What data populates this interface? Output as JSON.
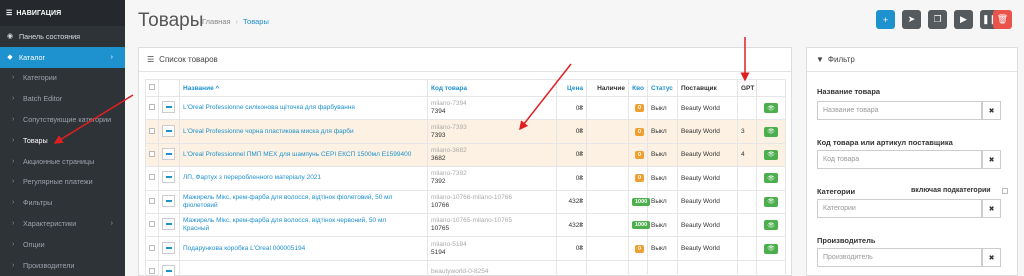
{
  "sidebar": {
    "header": "НАВИГАЦИЯ",
    "items": [
      {
        "label": "Панель состояния",
        "icon": "dashboard-icon"
      },
      {
        "label": "Каталог",
        "icon": "tag-icon"
      },
      {
        "label": "Категории"
      },
      {
        "label": "Batch Editor"
      },
      {
        "label": "Сопутствующие категории"
      },
      {
        "label": "Товары"
      },
      {
        "label": "Акционные страницы"
      },
      {
        "label": "Регулярные платежи"
      },
      {
        "label": "Фильтры"
      },
      {
        "label": "Характеристики"
      },
      {
        "label": "Опции"
      },
      {
        "label": "Производители"
      }
    ]
  },
  "header": {
    "title": "Товары",
    "breadcrumb": [
      "Главная",
      "Товары"
    ]
  },
  "product_list": {
    "title": "Список товаров",
    "columns": {
      "name": "Название ^",
      "code": "Код товара",
      "price": "Цена",
      "availability": "Наличие",
      "qty": "Кво",
      "status": "Статус",
      "supplier": "Поставщик",
      "gpt": "GPT"
    },
    "rows": [
      {
        "name": "L'Oreal Professionne силіконова щіточка для фарбування",
        "name2": "",
        "code_alt": "milano-7394",
        "code": "7394",
        "price": "0₴",
        "qty": "0",
        "qty_color": "orange",
        "status": "Выкл",
        "supplier": "Beauty World",
        "gpt": ""
      },
      {
        "name": "L'Oreal Professionne чорна пластикова миска для фарби",
        "name2": "",
        "code_alt": "milano-7393",
        "code": "7393",
        "price": "0₴",
        "qty": "0",
        "qty_color": "orange",
        "status": "Выкл",
        "supplier": "Beauty World",
        "gpt": "3"
      },
      {
        "name": "L'Oreal Professionnel ПМП MEX для шампунь СЕРІ ЕКСП 1500мл E1599400",
        "name2": "",
        "code_alt": "milano-3682",
        "code": "3682",
        "price": "0₴",
        "qty": "0",
        "qty_color": "orange",
        "status": "Выкл",
        "supplier": "Beauty World",
        "gpt": "4"
      },
      {
        "name": "ЛП, Фартух з переробленного матеріалу 2021",
        "name2": "",
        "code_alt": "milano-7392",
        "code": "7392",
        "price": "0₴",
        "qty": "0",
        "qty_color": "orange",
        "status": "Выкл",
        "supplier": "Beauty World",
        "gpt": ""
      },
      {
        "name": "Мажирель Мікс, крем-фарба для волосся, відтінок фіолетовий, 50 мл",
        "name2": "фіолетовий",
        "code_alt": "milano-10766-milano-10766",
        "code": "10766",
        "price": "432₴",
        "qty": "1000",
        "qty_color": "green",
        "status": "Выкл",
        "supplier": "Beauty World",
        "gpt": ""
      },
      {
        "name": "Мажирель Мікс, крем-фарба для волосся, відтінок червоний, 50 мл",
        "name2": "Красный",
        "code_alt": "milano-10765-milano-10765",
        "code": "10765",
        "price": "432₴",
        "qty": "1000",
        "qty_color": "green",
        "status": "Выкл",
        "supplier": "Beauty World",
        "gpt": ""
      },
      {
        "name": "Подарункова коробка L'Oreal 000005194",
        "name2": "",
        "code_alt": "milano-5194",
        "code": "5194",
        "price": "0₴",
        "qty": "0",
        "qty_color": "orange",
        "status": "Выкл",
        "supplier": "Beauty World",
        "gpt": ""
      },
      {
        "name": "",
        "name2": "",
        "code_alt": "beautyworld-0-8254",
        "code": "",
        "price": "",
        "qty": "",
        "qty_color": "",
        "status": "",
        "supplier": "",
        "gpt": ""
      }
    ]
  },
  "filter": {
    "title": "Фильтр",
    "name_label": "Название товара",
    "name_placeholder": "Название товара",
    "code_label": "Код товара или артикул поставщика",
    "code_placeholder": "Код товара",
    "category_label": "Категории",
    "subcategory_label": "включая подкатегории",
    "category_placeholder": "Категории",
    "manufacturer_label": "Производитель",
    "manufacturer_placeholder": "Производитель"
  },
  "colors": {
    "accent": "#1e91cf",
    "sidebar_bg": "#2e3338",
    "highlight_row": "#fcf1e2",
    "danger": "#e9554d",
    "success": "#4cae4c",
    "warning": "#f0a030",
    "annotation": "#e02020"
  }
}
